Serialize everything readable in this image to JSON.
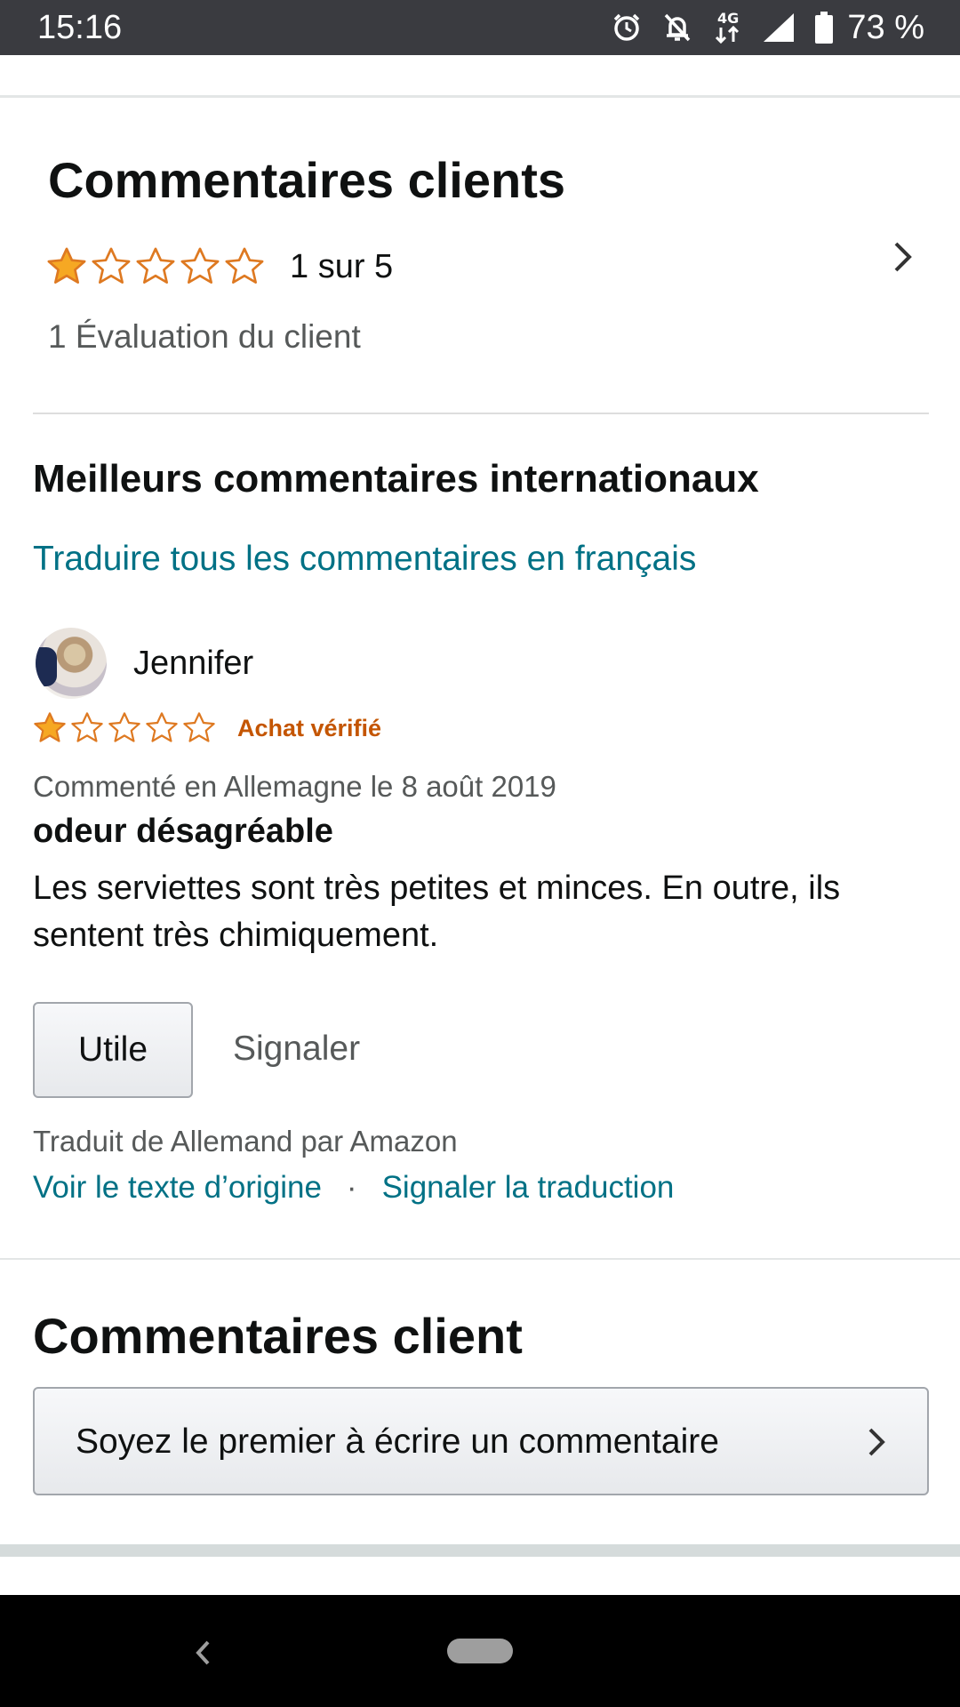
{
  "status_bar": {
    "time": "15:16",
    "battery_percent": "73 %",
    "network": "4G",
    "icons": [
      "alarm-icon",
      "bell-off-icon",
      "network-4g-icon",
      "signal-icon",
      "battery-icon"
    ]
  },
  "reviews_summary": {
    "title": "Commentaires clients",
    "rating_value": 1,
    "rating_max": 5,
    "rating_text": "1 sur 5",
    "ratings_count": "1 Évaluation du client"
  },
  "international": {
    "title": "Meilleurs commentaires internationaux",
    "translate_all_link": "Traduire tous les commentaires en français"
  },
  "review": {
    "reviewer": "Jennifer",
    "rating_value": 1,
    "verified_label": "Achat vérifié",
    "meta": "Commenté en Allemagne le 8 août 2019",
    "title": "odeur désagréable",
    "body": "Les serviettes sont très petites et minces. En outre, ils sentent très chimiquement.",
    "helpful_button": "Utile",
    "report_link": "Signaler",
    "translated_by": "Traduit de Allemand par Amazon",
    "view_original_link": "Voir le texte d’origine",
    "separator": "·",
    "report_translation_link": "Signaler la traduction"
  },
  "client_reviews": {
    "title": "Commentaires client",
    "write_review_button": "Soyez le premier à écrire un commentaire"
  },
  "colors": {
    "star_fill": "#f6a823",
    "star_outline": "#de7921",
    "link": "#007185",
    "verified": "#c45500",
    "status_bar_bg": "#3a3b40"
  }
}
